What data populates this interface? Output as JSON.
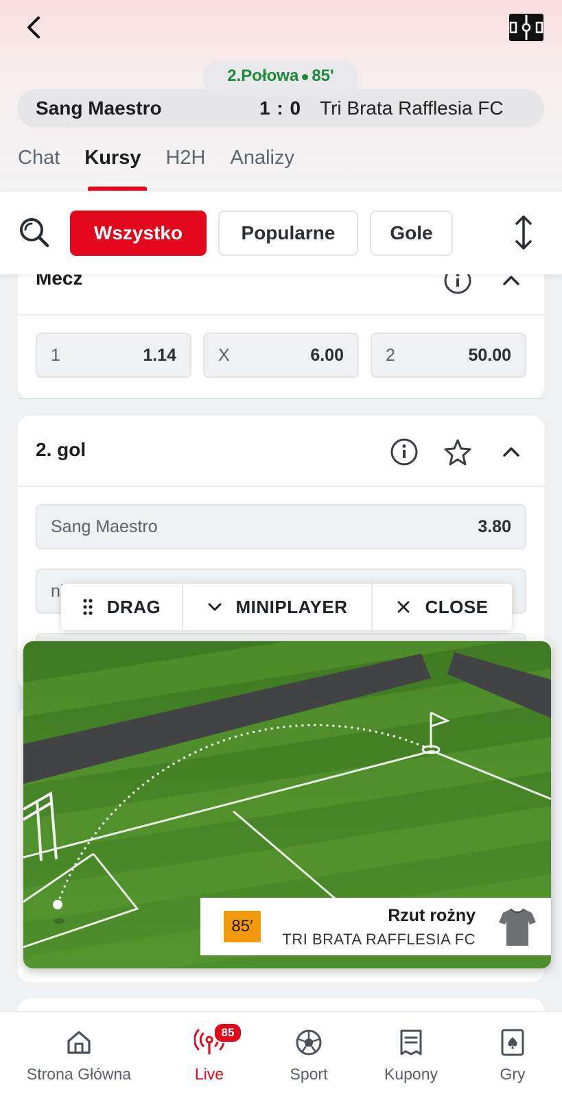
{
  "header": {
    "period": "2.Połowa",
    "minute": "85'",
    "home_team": "Sang Maestro",
    "score": "1 : 0",
    "away_team": "Tri Brata Rafflesia FC",
    "tabs": [
      "Chat",
      "Kursy",
      "H2H",
      "Analizy"
    ],
    "active_tab": "Kursy"
  },
  "filters": {
    "chips": [
      "Wszystko",
      "Popularne",
      "Gole"
    ],
    "active": "Wszystko"
  },
  "markets": {
    "mecz": {
      "title": "Mecz",
      "odds": [
        {
          "label": "1",
          "value": "1.14"
        },
        {
          "label": "X",
          "value": "6.00"
        },
        {
          "label": "2",
          "value": "50.00"
        }
      ]
    },
    "gol2": {
      "title": "2. gol",
      "rows": [
        {
          "label": "Sang Maestro",
          "value": "3.80"
        },
        {
          "label": "ni",
          "value": ""
        }
      ]
    }
  },
  "miniplayer": {
    "drag": "DRAG",
    "mini": "MINIPLAYER",
    "close": "CLOSE"
  },
  "event": {
    "minute": "85′",
    "title": "Rzut rożny",
    "team": "TRI BRATA RAFFLESIA FC"
  },
  "nav": {
    "items": [
      "Strona Główna",
      "Live",
      "Sport",
      "Kupony",
      "Gry"
    ],
    "live_badge": "85",
    "active": "Live"
  },
  "colors": {
    "accent": "#e3071b",
    "live_green": "#1e8a3c",
    "event_orange": "#f39a0c"
  }
}
